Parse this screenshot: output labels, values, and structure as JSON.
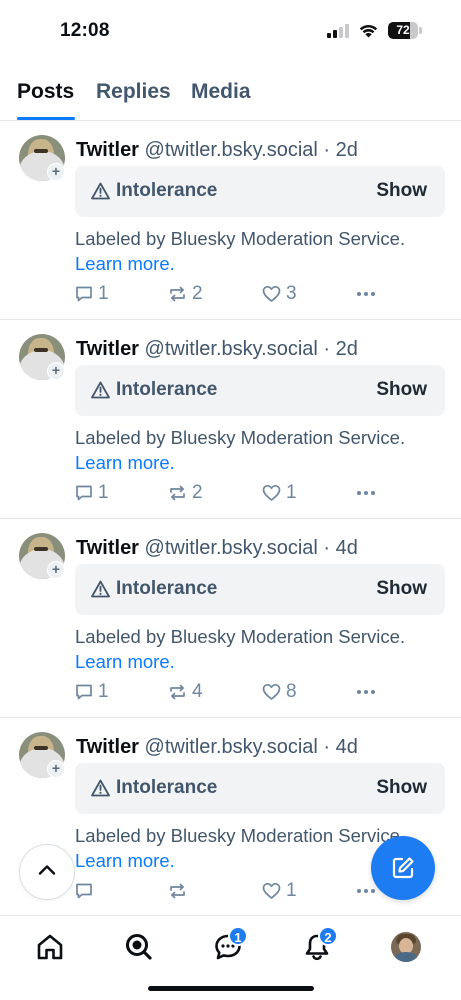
{
  "status_bar": {
    "time": "12:08",
    "battery": "72",
    "battery_level": 0.72
  },
  "tabs": [
    {
      "label": "Posts",
      "active": true
    },
    {
      "label": "Replies",
      "active": false
    },
    {
      "label": "Media",
      "active": false
    }
  ],
  "posts": [
    {
      "author_name": "Twitler",
      "author_handle": "@twitler.bsky.social",
      "separator": "·",
      "time": "2d",
      "label": "Intolerance",
      "show_label": "Show",
      "labeled_by": "Labeled by Bluesky Moderation Service.",
      "learn_more": "Learn more.",
      "replies": "1",
      "reposts": "2",
      "likes": "3"
    },
    {
      "author_name": "Twitler",
      "author_handle": "@twitler.bsky.social",
      "separator": "·",
      "time": "2d",
      "label": "Intolerance",
      "show_label": "Show",
      "labeled_by": "Labeled by Bluesky Moderation Service.",
      "learn_more": "Learn more.",
      "replies": "1",
      "reposts": "2",
      "likes": "1"
    },
    {
      "author_name": "Twitler",
      "author_handle": "@twitler.bsky.social",
      "separator": "·",
      "time": "4d",
      "label": "Intolerance",
      "show_label": "Show",
      "labeled_by": "Labeled by Bluesky Moderation Service.",
      "learn_more": "Learn more.",
      "replies": "1",
      "reposts": "4",
      "likes": "8"
    },
    {
      "author_name": "Twitler",
      "author_handle": "@twitler.bsky.social",
      "separator": "·",
      "time": "4d",
      "label": "Intolerance",
      "show_label": "Show",
      "labeled_by": "Labeled by Bluesky Moderation Service.",
      "learn_more": "Learn more.",
      "replies": "",
      "reposts": "",
      "likes": "1"
    }
  ],
  "bottom_nav": {
    "items": [
      "home-icon",
      "search-icon",
      "chat-icon",
      "bell-icon",
      "profile-avatar"
    ],
    "chat_badge": "1",
    "notifications_badge": "2"
  },
  "colors": {
    "accent": "#1e7cf2",
    "link": "#0a7aff",
    "muted": "#42576c",
    "label_bg": "#f1f3f5"
  }
}
